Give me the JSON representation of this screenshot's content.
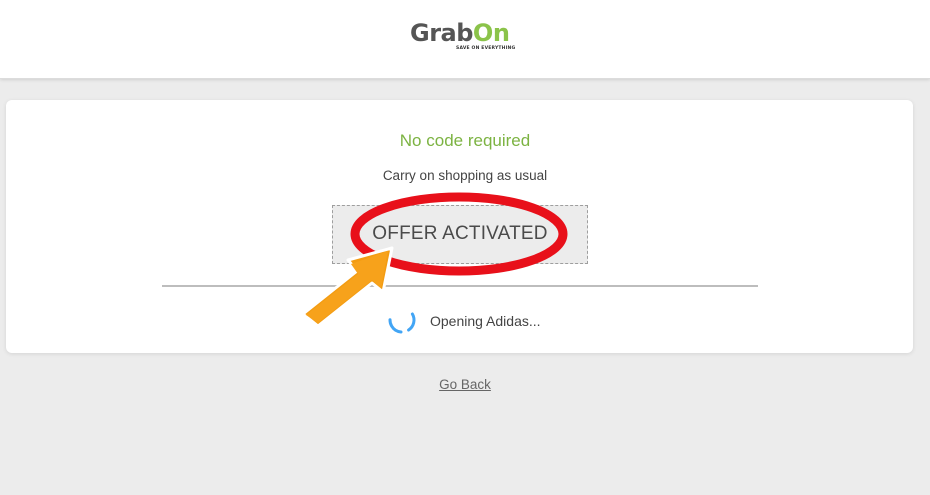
{
  "header": {
    "logo": {
      "word_grab": "Grab",
      "word_on": "On",
      "tagline": "SAVE ON EVERYTHING"
    }
  },
  "card": {
    "headline": "No code required",
    "subline": "Carry on shopping as usual",
    "offer_label": "OFFER ACTIVATED",
    "status_text": "Opening Adidas..."
  },
  "footer": {
    "go_back_label": "Go Back"
  },
  "colors": {
    "brand_green": "#7cb342",
    "annotation_red": "#e8101a",
    "annotation_orange": "#f39c12",
    "spinner_blue": "#42a5f5"
  },
  "icons": {
    "spinner": "loading-spinner-icon",
    "annotation_circle": "red-ellipse-highlight",
    "annotation_arrow": "orange-arrow-pointer"
  }
}
